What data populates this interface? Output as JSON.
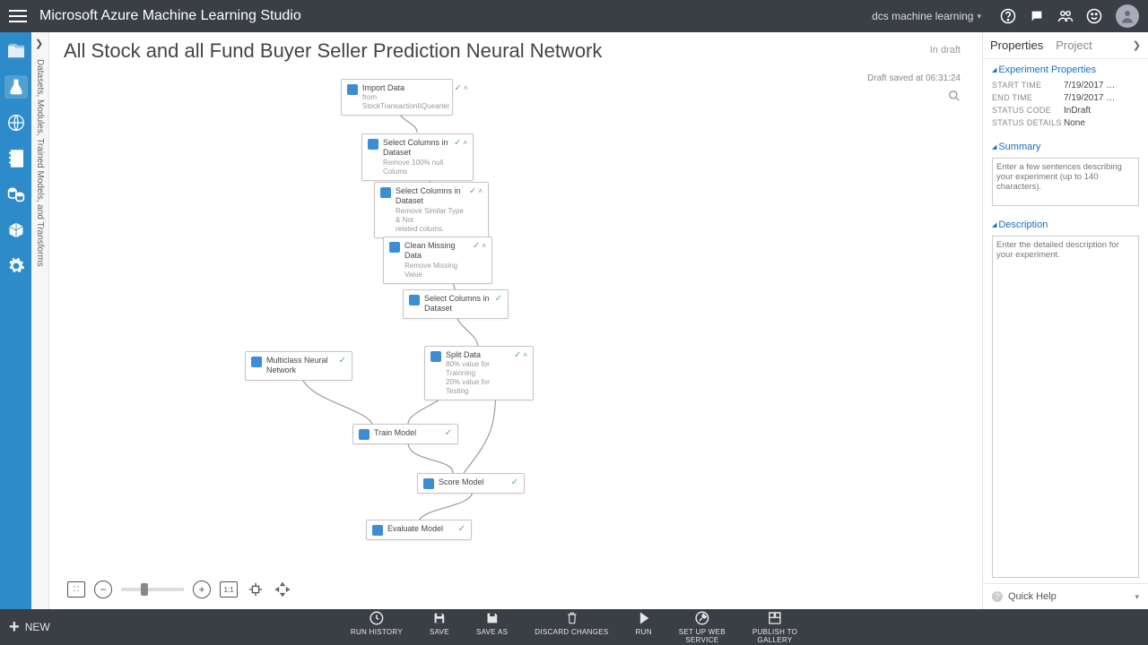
{
  "topbar": {
    "title": "Microsoft Azure Machine Learning Studio",
    "workspace": "dcs machine learning"
  },
  "palette": {
    "label": "Datasets, Modules, Trained Models, and Transforms"
  },
  "experiment": {
    "title": "All Stock and all Fund Buyer Seller Prediction Neural Network",
    "status": "In draft",
    "saved": "Draft saved at 06:31:24"
  },
  "nodes": {
    "import": {
      "title": "Import Data",
      "sub1": "from",
      "sub2": "StockTransactionIIQuearter"
    },
    "select1": {
      "title": "Select Columns in Dataset",
      "sub1": "Remove 100% null Colums"
    },
    "select2": {
      "title": "Select Columns in Dataset",
      "sub1": "Remove Similar Type & Not",
      "sub2": "related colums."
    },
    "clean": {
      "title": "Clean Missing Data",
      "sub1": "Remove Missing Value"
    },
    "select3": {
      "title": "Select Columns in Dataset"
    },
    "mnn": {
      "title": "Multiclass Neural Network"
    },
    "split": {
      "title": "Split Data",
      "sub1": "80% value for Trainning",
      "sub2": "20% value for Testing"
    },
    "train": {
      "title": "Train Model"
    },
    "score": {
      "title": "Score Model"
    },
    "eval": {
      "title": "Evaluate Model"
    }
  },
  "props": {
    "tab_properties": "Properties",
    "tab_project": "Project",
    "section_exp": "Experiment Properties",
    "start_k": "START TIME",
    "start_v": "7/19/2017 …",
    "end_k": "END TIME",
    "end_v": "7/19/2017 …",
    "code_k": "STATUS CODE",
    "code_v": "InDraft",
    "det_k": "STATUS DETAILS",
    "det_v": "None",
    "section_sum": "Summary",
    "sum_ph": "Enter a few sentences describing your experiment (up to 140 characters).",
    "section_desc": "Description",
    "desc_ph": "Enter the detailed description for your experiment.",
    "quick": "Quick Help"
  },
  "footer": {
    "new": "NEW",
    "runh": "RUN HISTORY",
    "save": "SAVE",
    "saveas": "SAVE AS",
    "discard": "DISCARD CHANGES",
    "run": "RUN",
    "setup": "SET UP WEB\nSERVICE",
    "publish": "PUBLISH TO\nGALLERY"
  }
}
